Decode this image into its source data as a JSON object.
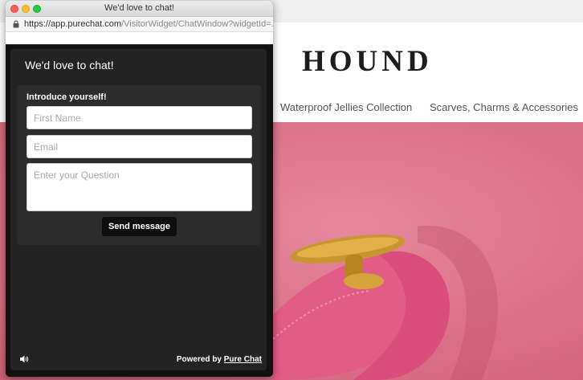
{
  "site": {
    "logo": "HOUND",
    "nav": [
      "Waterproof Jellies Collection",
      "Scarves, Charms & Accessories"
    ]
  },
  "popup": {
    "window_title": "We'd love to chat!",
    "url": {
      "host": "https://app.purechat.com",
      "path": "/VisitorWidget/ChatWindow?widgetId=..."
    },
    "chat": {
      "header": "We'd love to chat!",
      "intro_label": "Introduce yourself!",
      "fields": {
        "first_name_placeholder": "First Name",
        "email_placeholder": "Email",
        "question_placeholder": "Enter your Question"
      },
      "send_label": "Send message",
      "powered_by_prefix": "Powered by ",
      "powered_by_link": "Pure Chat"
    }
  },
  "icons": {
    "lock": "lock-icon",
    "sound": "speaker-icon"
  },
  "colors": {
    "chat_bg": "#232323",
    "card_bg": "#2c2c2c",
    "button_bg": "#0e0e0e",
    "hero_pink": "#db7189"
  }
}
